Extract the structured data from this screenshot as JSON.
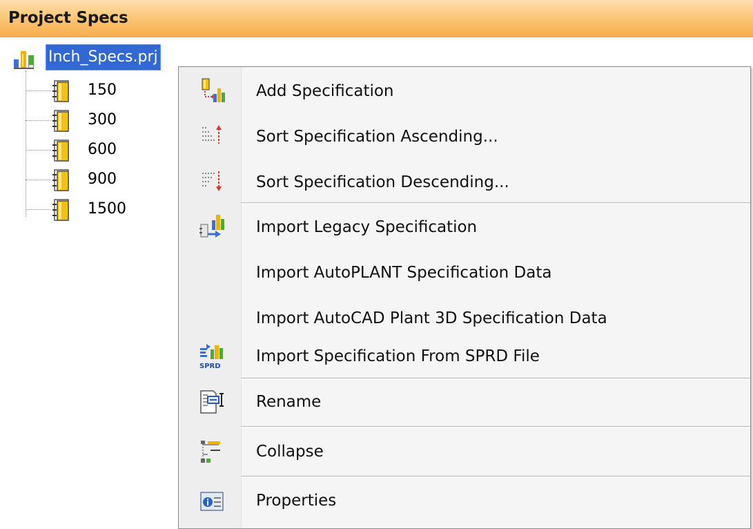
{
  "panel": {
    "title": "Project Specs"
  },
  "tree": {
    "root": {
      "label": "Inch_Specs.prj",
      "icon": "project-icon",
      "selected": true
    },
    "children": [
      {
        "label": "150",
        "icon": "spec-document-icon"
      },
      {
        "label": "300",
        "icon": "spec-document-icon"
      },
      {
        "label": "600",
        "icon": "spec-document-icon"
      },
      {
        "label": "900",
        "icon": "spec-document-icon"
      },
      {
        "label": "1500",
        "icon": "spec-document-icon"
      }
    ]
  },
  "context_menu": {
    "items": [
      {
        "label": "Add Specification",
        "icon": "add-specification-icon"
      },
      {
        "label": "Sort Specification Ascending...",
        "icon": "sort-ascending-icon"
      },
      {
        "label": "Sort Specification Descending...",
        "icon": "sort-descending-icon"
      },
      {
        "label": "Import Legacy Specification",
        "icon": "import-legacy-icon"
      },
      {
        "label": "Import AutoPLANT Specification Data",
        "icon": ""
      },
      {
        "label": "Import AutoCAD Plant 3D Specification Data",
        "icon": ""
      },
      {
        "label": "Import Specification From SPRD File",
        "icon": "sprd-import-icon",
        "icon_text": "SPRD"
      },
      {
        "label": "Rename",
        "icon": "rename-icon"
      },
      {
        "label": "Collapse",
        "icon": "collapse-tree-icon"
      },
      {
        "label": "Properties",
        "icon": "properties-icon"
      }
    ]
  },
  "colors": {
    "header_gradient_top": "#fde0ae",
    "header_gradient_bottom": "#f8ae4d",
    "selection": "#3168d4",
    "menu_background": "#f5f5f5"
  }
}
